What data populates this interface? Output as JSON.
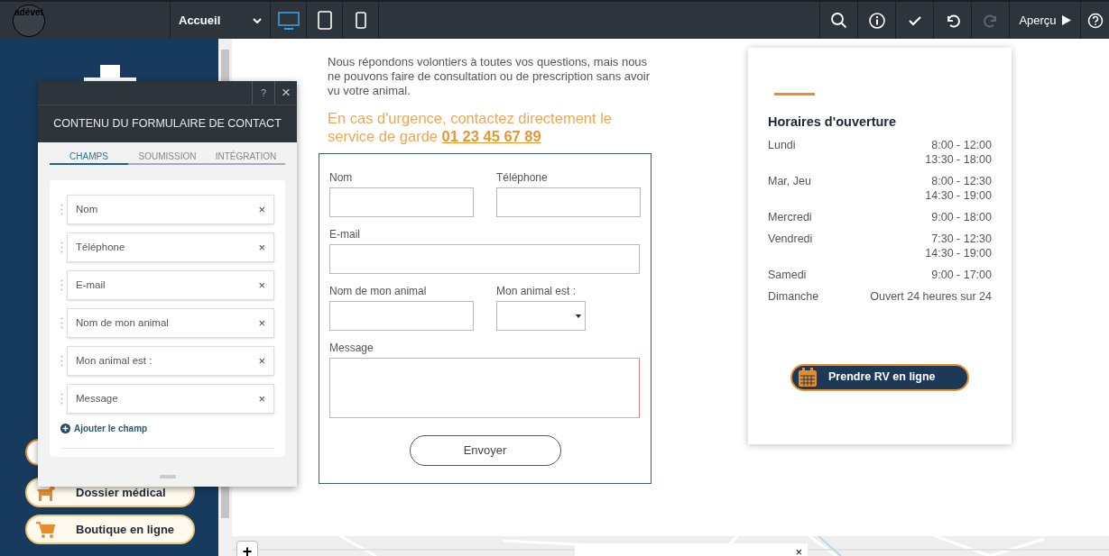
{
  "toolbar": {
    "logo": "adévet",
    "page_select": "Accueil",
    "devices": [
      {
        "kind": "desktop",
        "selected": true
      },
      {
        "kind": "tablet",
        "selected": false
      },
      {
        "kind": "phone",
        "selected": false
      }
    ],
    "tools": [
      {
        "kind": "search",
        "disabled": false
      },
      {
        "kind": "info",
        "disabled": false
      },
      {
        "kind": "check",
        "disabled": false
      },
      {
        "kind": "undo",
        "disabled": false
      },
      {
        "kind": "redo",
        "disabled": true
      }
    ],
    "preview": "Aperçu"
  },
  "sidebar": {
    "buttons": [
      {
        "kind": "dog",
        "label": "Dossier médical"
      },
      {
        "kind": "cart",
        "label": "Boutique en ligne"
      }
    ]
  },
  "dialog": {
    "help": "?",
    "close": "×",
    "title": "CONTENU DU FORMULAIRE DE CONTACT",
    "tabs": [
      {
        "label": "CHAMPS",
        "selected": true
      },
      {
        "label": "SOUMISSION",
        "selected": false
      },
      {
        "label": "INTÉGRATION",
        "selected": false
      }
    ],
    "fields": [
      "Nom",
      "Téléphone",
      "E-mail",
      "Nom de mon animal",
      "Mon animal est :",
      "Message"
    ],
    "remove": "×",
    "add": "Ajouter le champ"
  },
  "content": {
    "intro": "Nous répondons volontiers à toutes vos questions, mais nous ne pouvons faire de consultation ou de prescription sans avoir vu votre animal.",
    "urgent": "En cas d'urgence, contactez directement le service de garde",
    "phone": "01 23 45 67 89",
    "form": {
      "fields": [
        {
          "kind": "short",
          "label": "Nom"
        },
        {
          "kind": "short",
          "label": "Téléphone"
        },
        {
          "kind": "long",
          "label": "E-mail"
        },
        {
          "kind": "short",
          "label": "Nom de mon animal"
        },
        {
          "kind": "select",
          "label": "Mon animal est :"
        },
        {
          "kind": "textarea",
          "label": "Message"
        }
      ],
      "submit": "Envoyer"
    }
  },
  "hours": {
    "title": "Horaires d'ouverture",
    "rows": [
      {
        "day": "Lundi",
        "times": [
          "8:00 - 12:00",
          "13:30 - 18:00"
        ]
      },
      {
        "day": "Mar, Jeu",
        "times": [
          "8:00 - 12:30",
          "14:30 - 19:00"
        ]
      },
      {
        "day": "Mercredi",
        "times": [
          "9:00 - 18:00"
        ]
      },
      {
        "day": "Vendredi",
        "times": [
          "7:30 - 12:30",
          "14:30 - 19:00"
        ]
      },
      {
        "day": "Samedi",
        "times": [
          "9:00 - 17:00"
        ]
      },
      {
        "day": "Dimanche",
        "times": [
          "Ouvert 24 heures sur 24"
        ]
      }
    ],
    "button": "Prendre RV en ligne"
  },
  "map": {
    "zoom_in": "+",
    "popup_close": "×"
  }
}
